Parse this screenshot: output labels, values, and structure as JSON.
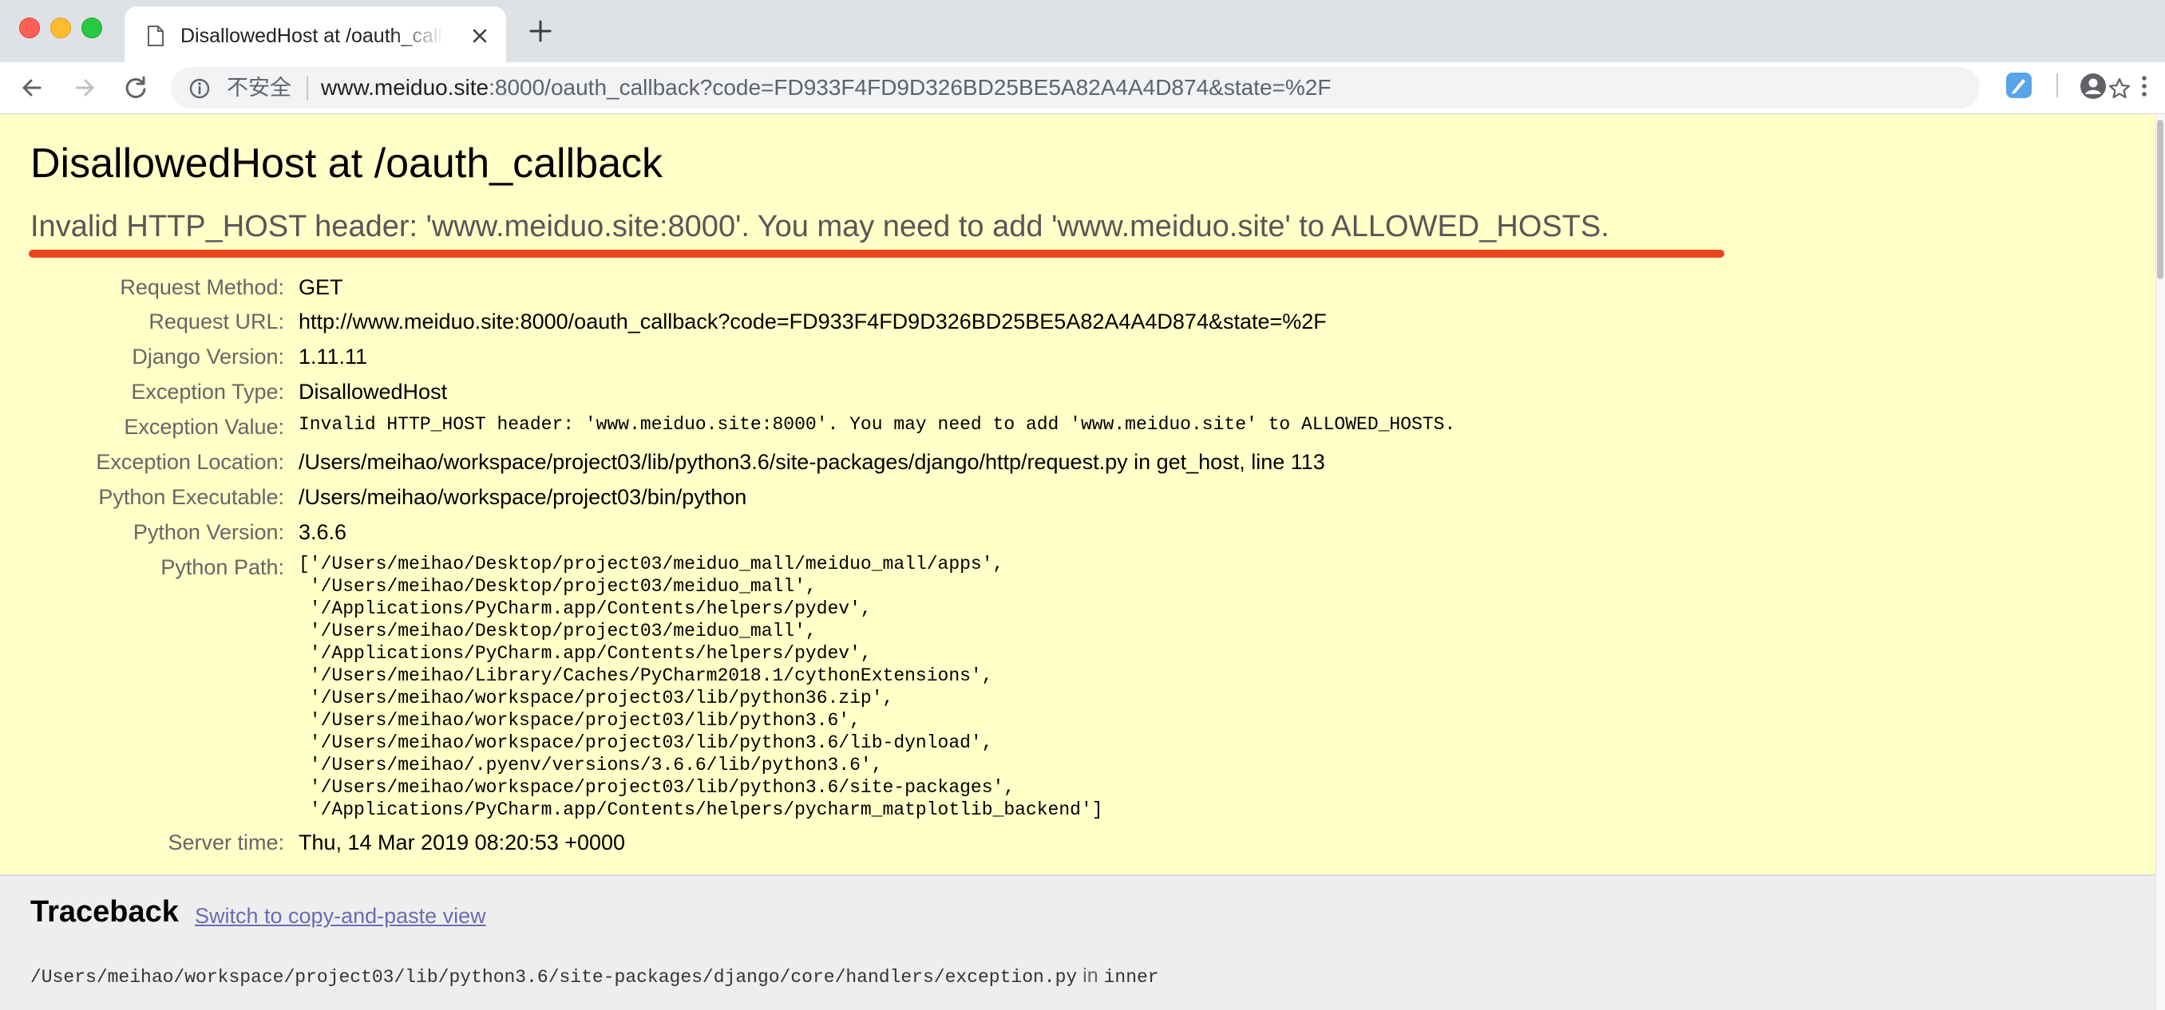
{
  "browser": {
    "tab": {
      "title": "DisallowedHost at /oauth_callback",
      "favicon": "document-icon"
    },
    "security_label": "不安全",
    "url_host": "www.meiduo.site",
    "url_rest": ":8000/oauth_callback?code=FD933F4FD9D326BD25BE5A82A4A4D874&state=%2F",
    "colors": {
      "tabbar": "#dee1e6",
      "omnibox": "#f1f3f4"
    }
  },
  "error": {
    "title": "DisallowedHost at /oauth_callback",
    "subtitle": "Invalid HTTP_HOST header: 'www.meiduo.site:8000'. You may need to add 'www.meiduo.site' to ALLOWED_HOSTS.",
    "highlight_color": "#e8461c"
  },
  "meta": [
    {
      "label": "Request Method:",
      "value": "GET"
    },
    {
      "label": "Request URL:",
      "value": "http://www.meiduo.site:8000/oauth_callback?code=FD933F4FD9D326BD25BE5A82A4A4D874&state=%2F"
    },
    {
      "label": "Django Version:",
      "value": "1.11.11"
    },
    {
      "label": "Exception Type:",
      "value": "DisallowedHost"
    },
    {
      "label": "Exception Value:",
      "value": "Invalid HTTP_HOST header: 'www.meiduo.site:8000'. You may need to add 'www.meiduo.site' to ALLOWED_HOSTS."
    },
    {
      "label": "Exception Location:",
      "value": "/Users/meihao/workspace/project03/lib/python3.6/site-packages/django/http/request.py in get_host, line 113"
    },
    {
      "label": "Python Executable:",
      "value": "/Users/meihao/workspace/project03/bin/python"
    },
    {
      "label": "Python Version:",
      "value": "3.6.6"
    },
    {
      "label": "Python Path:",
      "value": "['/Users/meihao/Desktop/project03/meiduo_mall/meiduo_mall/apps',\n '/Users/meihao/Desktop/project03/meiduo_mall',\n '/Applications/PyCharm.app/Contents/helpers/pydev',\n '/Users/meihao/Desktop/project03/meiduo_mall',\n '/Applications/PyCharm.app/Contents/helpers/pydev',\n '/Users/meihao/Library/Caches/PyCharm2018.1/cythonExtensions',\n '/Users/meihao/workspace/project03/lib/python36.zip',\n '/Users/meihao/workspace/project03/lib/python3.6',\n '/Users/meihao/workspace/project03/lib/python3.6/lib-dynload',\n '/Users/meihao/.pyenv/versions/3.6.6/lib/python3.6',\n '/Users/meihao/workspace/project03/lib/python3.6/site-packages',\n '/Applications/PyCharm.app/Contents/helpers/pycharm_matplotlib_backend']"
    },
    {
      "label": "Server time:",
      "value": "Thu, 14 Mar 2019 08:20:53 +0000"
    }
  ],
  "traceback": {
    "heading": "Traceback",
    "switch_link": "Switch to copy-and-paste view",
    "frame_path": "/Users/meihao/workspace/project03/lib/python3.6/site-packages/django/core/handlers/exception.py",
    "frame_in": "in",
    "frame_fn": "inner"
  }
}
